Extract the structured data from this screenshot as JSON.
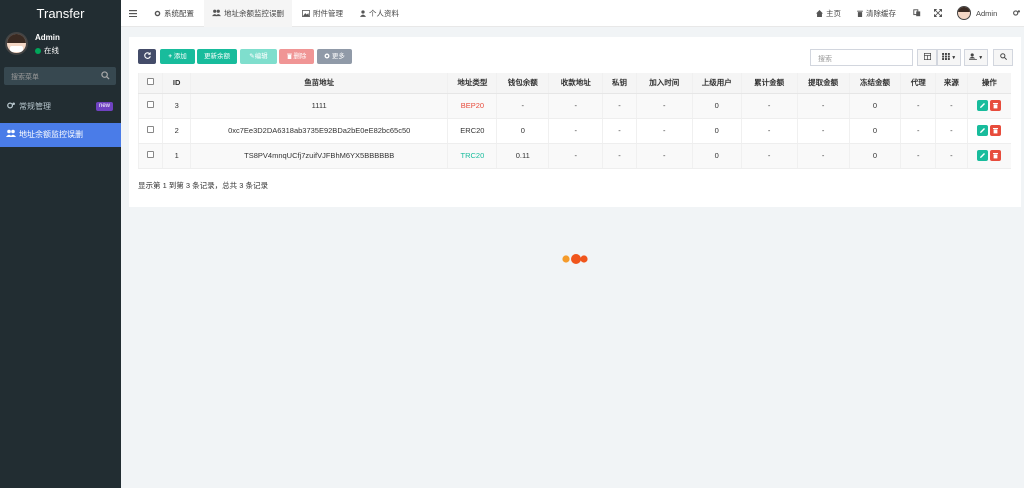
{
  "app": {
    "logo": "Transfer"
  },
  "user": {
    "name": "Admin",
    "status": "在线"
  },
  "sidebar": {
    "search_placeholder": "搜索菜单",
    "items": [
      {
        "label": "常规管理",
        "icon": "cogs-icon",
        "badge": "new"
      },
      {
        "label": "地址余额监控误删",
        "icon": "users-icon"
      }
    ]
  },
  "topbar": {
    "tabs": [
      {
        "label": "系统配置",
        "icon": "gear-icon"
      },
      {
        "label": "地址余额监控误删",
        "icon": "users-icon"
      },
      {
        "label": "附件管理",
        "icon": "image-icon"
      },
      {
        "label": "个人资料",
        "icon": "user-icon"
      }
    ],
    "home_label": "主页",
    "clear_cache_label": "清除缓存",
    "admin_label": "Admin"
  },
  "toolbar": {
    "add_label": "添加",
    "update_balance_label": "更新余额",
    "edit_label": "编辑",
    "delete_label": "删除",
    "more_label": "更多",
    "search_placeholder": "搜索"
  },
  "table": {
    "columns": [
      "ID",
      "鱼苗地址",
      "地址类型",
      "钱包余额",
      "收款地址",
      "私钥",
      "加入时间",
      "上级用户",
      "累计金额",
      "提取金额",
      "冻结金额",
      "代理",
      "来源",
      "操作"
    ],
    "rows": [
      {
        "id": "3",
        "address": "1111",
        "type": "BEP20",
        "balance": "-",
        "receive": "-",
        "key": "-",
        "time": "-",
        "parent": "0",
        "total": "-",
        "withdrawn": "-",
        "frozen": "0",
        "agent": "-",
        "source": "-"
      },
      {
        "id": "2",
        "address": "0xc7Ee3D2DA6318ab3735E92BDa2bE0eE82bc65c50",
        "type": "ERC20",
        "balance": "0",
        "receive": "-",
        "key": "-",
        "time": "-",
        "parent": "0",
        "total": "-",
        "withdrawn": "-",
        "frozen": "0",
        "agent": "-",
        "source": "-"
      },
      {
        "id": "1",
        "address": "TS8PV4mnqUCfj7zuifVJFBhM6YX5BBBBBB",
        "type": "TRC20",
        "balance": "0.11",
        "receive": "-",
        "key": "-",
        "time": "-",
        "parent": "0",
        "total": "-",
        "withdrawn": "-",
        "frozen": "0",
        "agent": "-",
        "source": "-"
      }
    ],
    "summary": "显示第 1 到第 3 条记录，总共 3 条记录"
  },
  "colors": {
    "sidebar_bg": "#222d32",
    "active_menu": "#4a7ce8",
    "green": "#18bc9c",
    "red": "#e74c3c"
  }
}
